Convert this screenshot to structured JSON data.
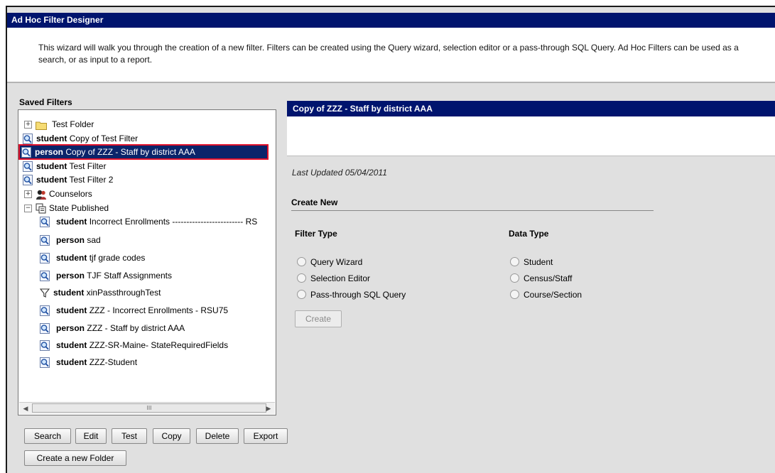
{
  "window": {
    "title": "Ad Hoc Filter Designer",
    "description": "This wizard will walk you through the creation of a new filter. Filters can be created using the Query wizard, selection editor or a pass-through SQL Query. Ad Hoc Filters can be used as a search, or as input to a report."
  },
  "saved_filters": {
    "label": "Saved Filters",
    "items": [
      {
        "type": "",
        "name": "Test Folder",
        "icon": "folder-icon",
        "expander": "+"
      },
      {
        "type": "student",
        "name": "Copy of Test Filter",
        "icon": "magnifier-icon"
      },
      {
        "type": "person",
        "name": "Copy of ZZZ - Staff by district AAA",
        "icon": "magnifier-icon",
        "selected": true
      },
      {
        "type": "student",
        "name": "Test Filter",
        "icon": "magnifier-icon"
      },
      {
        "type": "student",
        "name": "Test Filter 2",
        "icon": "magnifier-icon"
      },
      {
        "type": "",
        "name": "Counselors",
        "icon": "people-icon",
        "expander": "+"
      },
      {
        "type": "",
        "name": "State Published",
        "icon": "published-icon",
        "expander": "−"
      },
      {
        "type": "student",
        "name": "Incorrect Enrollments ------------------------- RS",
        "icon": "magnifier-icon"
      },
      {
        "type": "person",
        "name": "sad",
        "icon": "magnifier-icon"
      },
      {
        "type": "student",
        "name": "tjf grade codes",
        "icon": "magnifier-icon"
      },
      {
        "type": "person",
        "name": "TJF Staff Assignments",
        "icon": "magnifier-icon"
      },
      {
        "type": "student",
        "name": "xinPassthroughTest",
        "icon": "funnel-icon"
      },
      {
        "type": "student",
        "name": "ZZZ - Incorrect Enrollments - RSU75",
        "icon": "magnifier-icon"
      },
      {
        "type": "person",
        "name": "ZZZ - Staff by district AAA",
        "icon": "magnifier-icon"
      },
      {
        "type": "student",
        "name": "ZZZ-SR-Maine- StateRequiredFields",
        "icon": "magnifier-icon"
      },
      {
        "type": "student",
        "name": "ZZZ-Student",
        "icon": "magnifier-icon"
      }
    ],
    "scroll_thumb": "III"
  },
  "buttons": {
    "search": "Search",
    "edit": "Edit",
    "test": "Test",
    "copy": "Copy",
    "delete": "Delete",
    "export": "Export",
    "new_folder": "Create a new Folder"
  },
  "detail": {
    "title": "Copy of ZZZ - Staff by district AAA",
    "last_updated": "Last Updated 05/04/2011",
    "create_new": "Create New",
    "filter_type_label": "Filter Type",
    "filter_types": [
      "Query Wizard",
      "Selection Editor",
      "Pass-through SQL Query"
    ],
    "data_type_label": "Data Type",
    "data_types": [
      "Student",
      "Census/Staff",
      "Course/Section"
    ],
    "create_button": "Create"
  },
  "colors": {
    "title_bar": "#00146e",
    "selection": "#0a246a",
    "selection_outline": "#e0102a"
  }
}
